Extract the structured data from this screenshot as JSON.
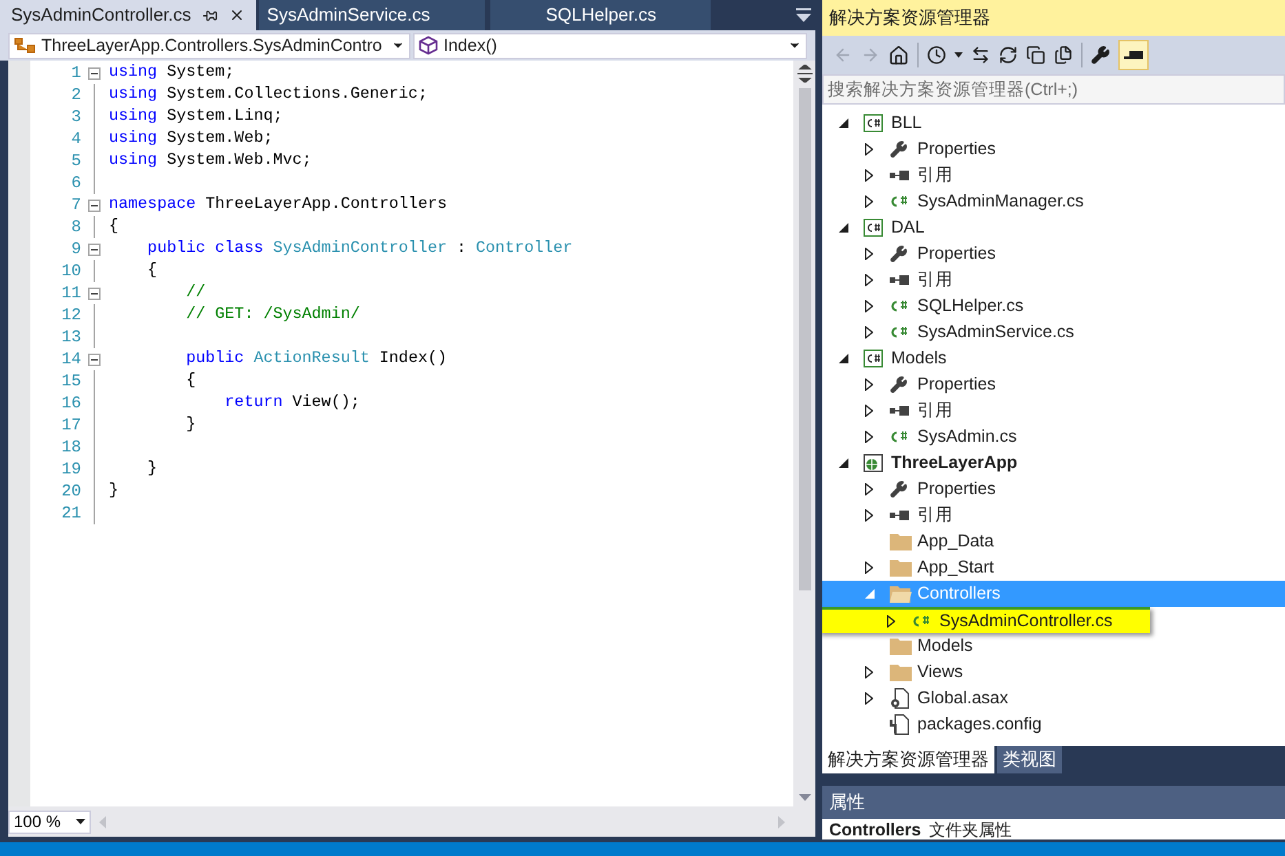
{
  "tabs": [
    {
      "label": "SysAdminController.cs",
      "selected": true,
      "pinned": true
    },
    {
      "label": "SysAdminService.cs",
      "selected": false,
      "pinned": false
    },
    {
      "label": "SQLHelper.cs",
      "selected": false,
      "pinned": false
    }
  ],
  "nav": {
    "type_combo": "ThreeLayerApp.Controllers.SysAdminContro",
    "member_combo": "Index()"
  },
  "code": [
    {
      "number": "1",
      "fold": true,
      "tokens": [
        {
          "kind": "keyword",
          "text": "using"
        },
        {
          "kind": "plain",
          "text": " System;"
        }
      ]
    },
    {
      "number": "2",
      "fold": false,
      "tokens": [
        {
          "kind": "keyword",
          "text": "using"
        },
        {
          "kind": "plain",
          "text": " System.Collections.Generic;"
        }
      ]
    },
    {
      "number": "3",
      "fold": false,
      "tokens": [
        {
          "kind": "keyword",
          "text": "using"
        },
        {
          "kind": "plain",
          "text": " System.Linq;"
        }
      ]
    },
    {
      "number": "4",
      "fold": false,
      "tokens": [
        {
          "kind": "keyword",
          "text": "using"
        },
        {
          "kind": "plain",
          "text": " System.Web;"
        }
      ]
    },
    {
      "number": "5",
      "fold": false,
      "tokens": [
        {
          "kind": "keyword",
          "text": "using"
        },
        {
          "kind": "plain",
          "text": " System.Web.Mvc;"
        }
      ]
    },
    {
      "number": "6",
      "fold": false
    },
    {
      "number": "7",
      "fold": true,
      "tokens": [
        {
          "kind": "keyword",
          "text": "namespace"
        },
        {
          "kind": "plain",
          "text": " ThreeLayerApp.Controllers"
        }
      ]
    },
    {
      "number": "8",
      "fold": false,
      "tokens": [
        {
          "kind": "plain",
          "text": "{"
        }
      ]
    },
    {
      "number": "9",
      "fold": true,
      "tokens": [
        {
          "kind": "keyword",
          "text": "    public class"
        },
        {
          "kind": "type",
          "text": " SysAdminController"
        },
        {
          "kind": "plain",
          "text": " : "
        },
        {
          "kind": "type",
          "text": "Controller"
        }
      ]
    },
    {
      "number": "10",
      "fold": false,
      "tokens": [
        {
          "kind": "plain",
          "text": "    {"
        }
      ]
    },
    {
      "number": "11",
      "fold": true,
      "tokens": [
        {
          "kind": "comment",
          "text": "        //"
        }
      ]
    },
    {
      "number": "12",
      "fold": false,
      "tokens": [
        {
          "kind": "comment",
          "text": "        // GET: /SysAdmin/"
        }
      ]
    },
    {
      "number": "13",
      "fold": false
    },
    {
      "number": "14",
      "fold": true,
      "tokens": [
        {
          "kind": "keyword",
          "text": "        public"
        },
        {
          "kind": "type",
          "text": " ActionResult"
        },
        {
          "kind": "plain",
          "text": " Index()"
        }
      ]
    },
    {
      "number": "15",
      "fold": false,
      "tokens": [
        {
          "kind": "plain",
          "text": "        {"
        }
      ]
    },
    {
      "number": "16",
      "fold": false,
      "tokens": [
        {
          "kind": "keyword",
          "text": "            return"
        },
        {
          "kind": "plain",
          "text": " View();"
        }
      ]
    },
    {
      "number": "17",
      "fold": false,
      "tokens": [
        {
          "kind": "plain",
          "text": "        }"
        }
      ]
    },
    {
      "number": "18",
      "fold": false
    },
    {
      "number": "19",
      "fold": false,
      "tokens": [
        {
          "kind": "plain",
          "text": "    }"
        }
      ]
    },
    {
      "number": "20",
      "fold": false,
      "tokens": [
        {
          "kind": "plain",
          "text": "}"
        }
      ]
    },
    {
      "number": "21",
      "fold": false
    }
  ],
  "zoom": "100 %",
  "explorer": {
    "title": "解决方案资源管理器",
    "search": {
      "placeholder": "搜索解决方案资源管理器(Ctrl+;)"
    },
    "tree": [
      {
        "label": "BLL",
        "kind": "project",
        "expanded": true,
        "selected": false,
        "highlighted": false,
        "bold": false,
        "children": [
          {
            "label": "Properties",
            "kind": "properties",
            "expanded": false,
            "selected": false,
            "highlighted": false,
            "bold": false
          },
          {
            "label": "引用",
            "kind": "references",
            "expanded": false,
            "selected": false,
            "highlighted": false,
            "bold": false
          },
          {
            "label": "SysAdminManager.cs",
            "kind": "csharp",
            "expanded": false,
            "selected": false,
            "highlighted": false,
            "bold": false
          }
        ]
      },
      {
        "label": "DAL",
        "kind": "project",
        "expanded": true,
        "selected": false,
        "highlighted": false,
        "bold": false,
        "children": [
          {
            "label": "Properties",
            "kind": "properties",
            "expanded": false,
            "selected": false,
            "highlighted": false,
            "bold": false
          },
          {
            "label": "引用",
            "kind": "references",
            "expanded": false,
            "selected": false,
            "highlighted": false,
            "bold": false
          },
          {
            "label": "SQLHelper.cs",
            "kind": "csharp",
            "expanded": false,
            "selected": false,
            "highlighted": false,
            "bold": false
          },
          {
            "label": "SysAdminService.cs",
            "kind": "csharp",
            "expanded": false,
            "selected": false,
            "highlighted": false,
            "bold": false
          }
        ]
      },
      {
        "label": "Models",
        "kind": "project",
        "expanded": true,
        "selected": false,
        "highlighted": false,
        "bold": false,
        "children": [
          {
            "label": "Properties",
            "kind": "properties",
            "expanded": false,
            "selected": false,
            "highlighted": false,
            "bold": false
          },
          {
            "label": "引用",
            "kind": "references",
            "expanded": false,
            "selected": false,
            "highlighted": false,
            "bold": false
          },
          {
            "label": "SysAdmin.cs",
            "kind": "csharp",
            "expanded": false,
            "selected": false,
            "highlighted": false,
            "bold": false
          }
        ]
      },
      {
        "label": "ThreeLayerApp",
        "kind": "web-project",
        "expanded": true,
        "selected": false,
        "highlighted": false,
        "bold": true,
        "children": [
          {
            "label": "Properties",
            "kind": "properties",
            "expanded": false,
            "selected": false,
            "highlighted": false,
            "bold": false
          },
          {
            "label": "引用",
            "kind": "references",
            "expanded": false,
            "selected": false,
            "highlighted": false,
            "bold": false
          },
          {
            "label": "App_Data",
            "kind": "folder",
            "selected": false,
            "highlighted": false,
            "bold": false
          },
          {
            "label": "App_Start",
            "kind": "folder",
            "expanded": false,
            "selected": false,
            "highlighted": false,
            "bold": false
          },
          {
            "label": "Controllers",
            "kind": "folder-open",
            "expanded": true,
            "selected": true,
            "highlighted": false,
            "bold": false,
            "children": [
              {
                "label": "SysAdminController.cs",
                "kind": "csharp",
                "expanded": false,
                "selected": false,
                "highlighted": true,
                "bold": false
              }
            ]
          },
          {
            "label": "Models",
            "kind": "folder",
            "selected": false,
            "highlighted": false,
            "bold": false
          },
          {
            "label": "Views",
            "kind": "folder",
            "expanded": false,
            "selected": false,
            "highlighted": false,
            "bold": false
          },
          {
            "label": "Global.asax",
            "kind": "asax",
            "expanded": false,
            "selected": false,
            "highlighted": false,
            "bold": false
          },
          {
            "label": "packages.config",
            "kind": "config",
            "selected": false,
            "highlighted": false,
            "bold": false
          }
        ]
      }
    ]
  },
  "bottom_tabs": [
    {
      "label": "解决方案资源管理器",
      "selected": true
    },
    {
      "label": "类视图",
      "selected": false
    }
  ],
  "properties": {
    "title": "属性",
    "object": "Controllers",
    "object_type": "文件夹属性"
  }
}
